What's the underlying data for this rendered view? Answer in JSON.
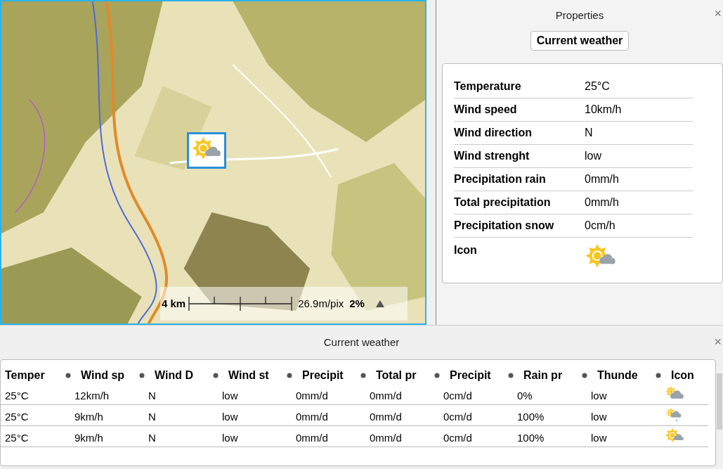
{
  "map": {
    "scale": {
      "distance": "4 km",
      "resolution": "26.9m/pix",
      "zoom": "2%"
    },
    "marker": {
      "icon": {
        "kind": "partly_sunny"
      }
    }
  },
  "properties": {
    "title": "Properties",
    "close": "×",
    "button": "Current weather",
    "rows": [
      {
        "label": "Temperature",
        "value": "25°C"
      },
      {
        "label": "Wind speed",
        "value": "10km/h"
      },
      {
        "label": "Wind direction",
        "value": "N"
      },
      {
        "label": "Wind strenght",
        "value": "low"
      },
      {
        "label": "Precipitation rain",
        "value": "0mm/h"
      },
      {
        "label": "Total precipitation",
        "value": "0mm/h"
      },
      {
        "label": "Precipitation snow",
        "value": "0cm/h"
      },
      {
        "label": "Icon",
        "icon": {
          "kind": "partly_sunny"
        }
      }
    ]
  },
  "weather_table": {
    "title": "Current weather",
    "close": "×",
    "columns": [
      "Temper",
      "Wind sp",
      "Wind D",
      "Wind st",
      "Precipit",
      "Total pr",
      "Precipit",
      "Rain pr",
      "Thunde",
      "Icon"
    ],
    "rows": [
      {
        "cells": [
          "25°C",
          "12km/h",
          "N",
          "low",
          "0mm/d",
          "0mm/d",
          "0cm/d",
          "0%",
          "low"
        ],
        "icon": {
          "kind": "cloudy"
        }
      },
      {
        "cells": [
          "25°C",
          "9km/h",
          "N",
          "low",
          "0mm/d",
          "0mm/d",
          "0cm/d",
          "100%",
          "low"
        ],
        "icon": {
          "kind": "showers"
        }
      },
      {
        "cells": [
          "25°C",
          "9km/h",
          "N",
          "low",
          "0mm/d",
          "0mm/d",
          "0cm/d",
          "100%",
          "low"
        ],
        "icon": {
          "kind": "partly_sunny"
        }
      }
    ]
  }
}
